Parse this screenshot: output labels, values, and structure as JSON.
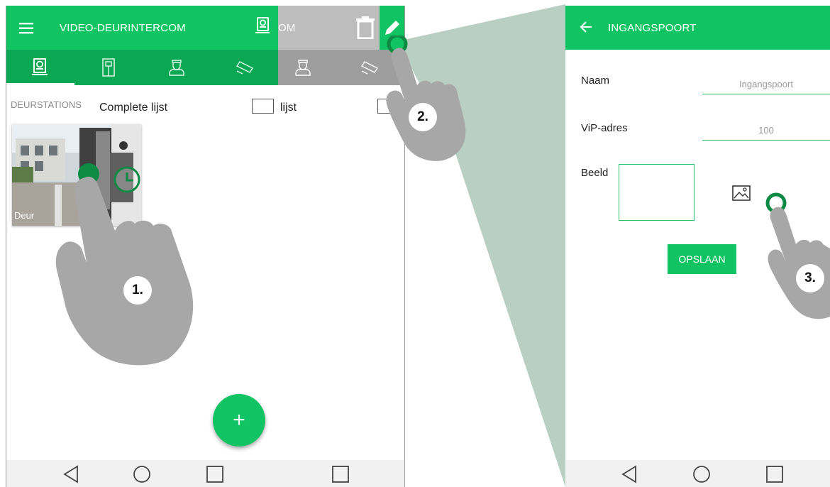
{
  "panel1": {
    "app_title": "VIDEO-DEURINTERCOM",
    "tabs": [
      "doorstation-tab",
      "door-tab",
      "guard-tab",
      "camera-tab"
    ],
    "section_label": "DEURSTATIONS",
    "list_title": "Complete lijst",
    "card": {
      "label": "Deur"
    },
    "fab_label": "+"
  },
  "panel2": {
    "title_fragment": "OM",
    "list_fragment": "lijst"
  },
  "panel3": {
    "title": "INGANGSPOORT",
    "fields": {
      "name_label": "Naam",
      "name_value": "Ingangspoort",
      "vip_label": "ViP-adres",
      "vip_value": "100",
      "image_label": "Beeld"
    },
    "save_label": "OPSLAAN"
  },
  "steps": [
    "1.",
    "2.",
    "3."
  ],
  "colors": {
    "accent": "#10c463",
    "accent_dark": "#0aa854",
    "funnel": "#b9cfc3",
    "hand": "#a7a7a7"
  }
}
